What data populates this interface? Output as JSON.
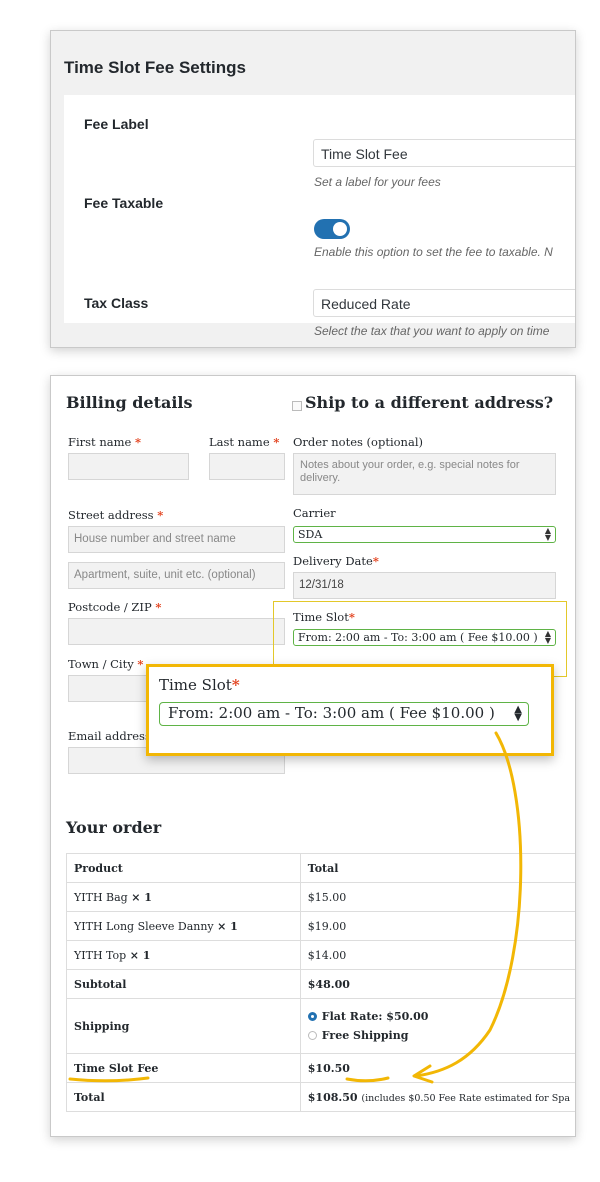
{
  "settings": {
    "title": "Time Slot Fee Settings",
    "fee_label": {
      "label": "Fee Label",
      "value": "Time Slot Fee",
      "description": "Set a label for your fees"
    },
    "fee_taxable": {
      "label": "Fee Taxable",
      "enabled": true,
      "description": "Enable this option to set the fee to taxable. N"
    },
    "tax_class": {
      "label": "Tax Class",
      "value": "Reduced Rate",
      "description": "Select the tax that you want to apply on time"
    }
  },
  "checkout": {
    "billing_title": "Billing details",
    "ship_label": "Ship to a different address?",
    "first_name_label": "First name",
    "last_name_label": "Last name",
    "order_notes_label": "Order notes (optional)",
    "order_notes_placeholder": "Notes about your order, e.g. special notes for delivery.",
    "street_label": "Street address",
    "street_placeholder": "House number and street name",
    "apartment_placeholder": "Apartment, suite, unit etc. (optional)",
    "carrier_label": "Carrier",
    "carrier_value": "SDA",
    "delivery_date_label": "Delivery Date",
    "delivery_date_value": "12/31/18",
    "postcode_label": "Postcode / ZIP",
    "town_label": "Town / City",
    "email_label": "Email address",
    "time_slot_label": "Time Slot",
    "time_slot_value": "From: 2:00 am - To: 3:00 am ( Fee $10.00 )",
    "required_mark": "*"
  },
  "order": {
    "title": "Your order",
    "header": {
      "product": "Product",
      "total": "Total"
    },
    "items": [
      {
        "name": "YITH Bag",
        "qty": "× 1",
        "total": "$15.00"
      },
      {
        "name": "YITH Long Sleeve Danny",
        "qty": "× 1",
        "total": "$19.00"
      },
      {
        "name": "YITH Top",
        "qty": "× 1",
        "total": "$14.00"
      }
    ],
    "subtotal": {
      "label": "Subtotal",
      "value": "$48.00"
    },
    "shipping": {
      "label": "Shipping",
      "options": [
        {
          "label": "Flat Rate: $50.00",
          "selected": true
        },
        {
          "label": "Free Shipping",
          "selected": false
        }
      ]
    },
    "fee": {
      "label": "Time Slot Fee",
      "value": "$10.50"
    },
    "total": {
      "label": "Total",
      "value": "$108.50",
      "note": "(includes $0.50 Fee Rate estimated for Spa"
    }
  },
  "callout": {
    "label": "Time Slot",
    "required_mark": "*",
    "value": "From: 2:00 am - To: 3:00 am ( Fee $10.00 )"
  },
  "colors": {
    "accent_blue": "#2271b1",
    "highlight_yellow": "#f2b705",
    "select_border_green": "#5fb346",
    "required_red": "#e2401c"
  }
}
